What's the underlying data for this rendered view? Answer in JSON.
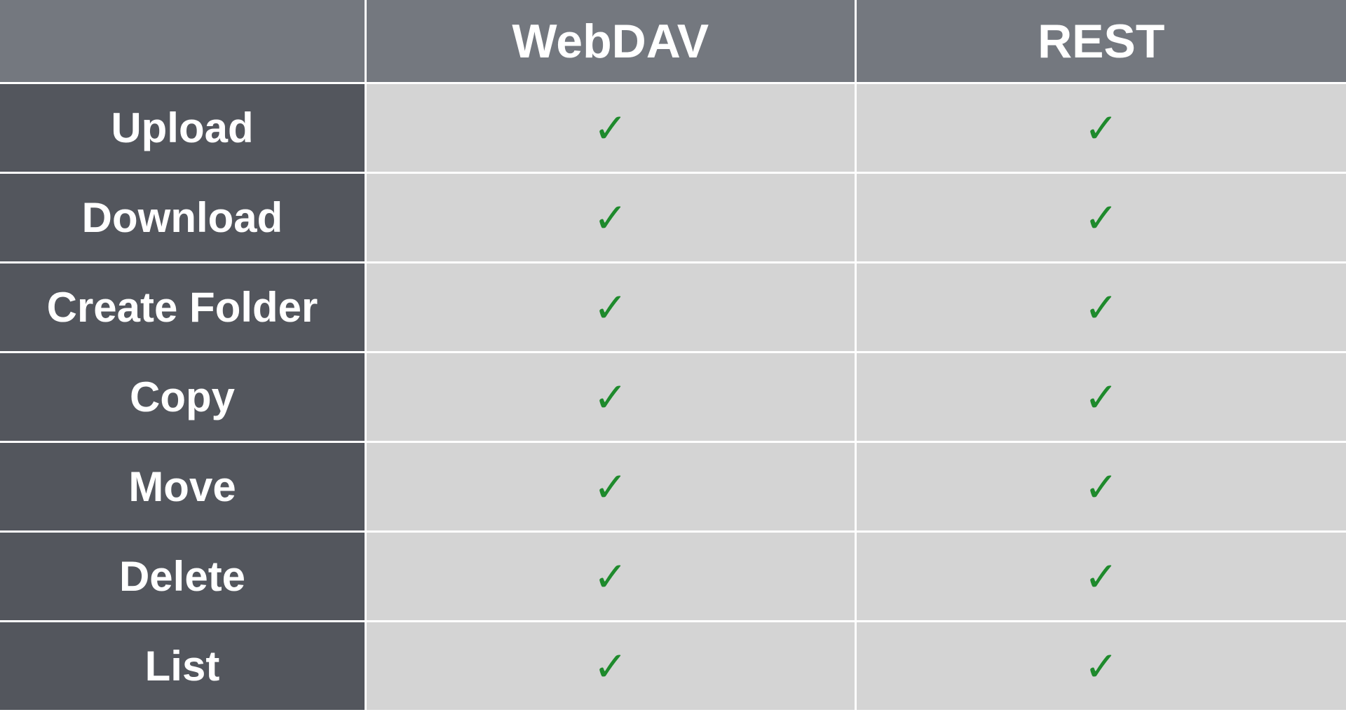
{
  "columns": [
    "WebDAV",
    "REST"
  ],
  "rows": [
    {
      "label": "Upload",
      "values": [
        true,
        true
      ]
    },
    {
      "label": "Download",
      "values": [
        true,
        true
      ]
    },
    {
      "label": "Create Folder",
      "values": [
        true,
        true
      ]
    },
    {
      "label": "Copy",
      "values": [
        true,
        true
      ]
    },
    {
      "label": "Move",
      "values": [
        true,
        true
      ]
    },
    {
      "label": "Delete",
      "values": [
        true,
        true
      ]
    },
    {
      "label": "List",
      "values": [
        true,
        true
      ]
    }
  ],
  "check_glyph": "✓"
}
